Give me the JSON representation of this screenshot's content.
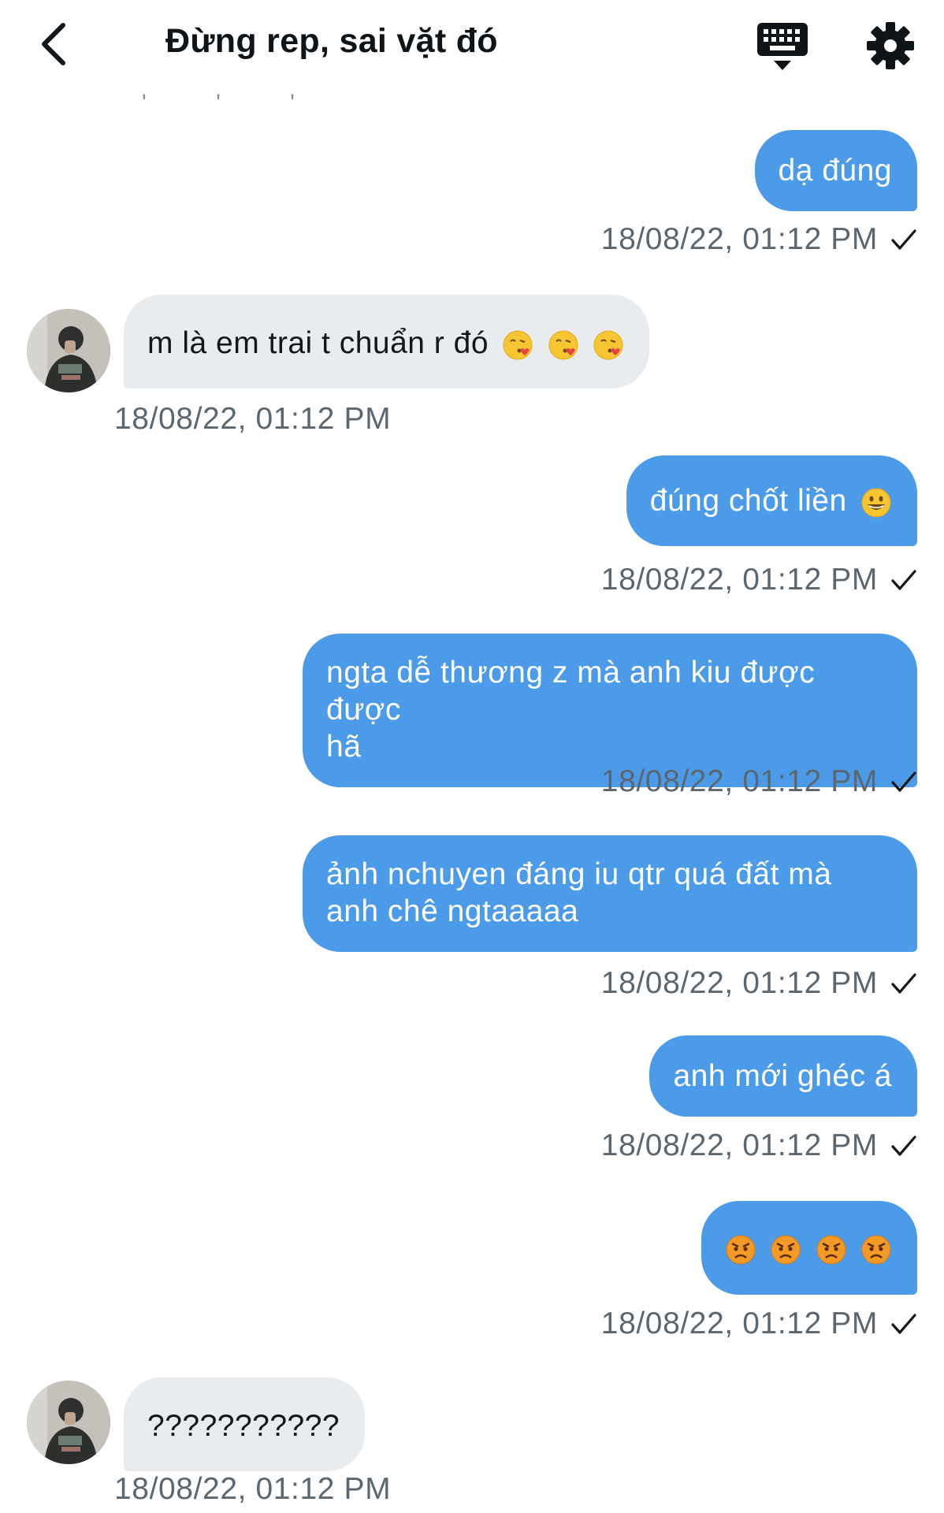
{
  "header": {
    "title": "Đừng rep, sai vặt đó"
  },
  "messages": [
    {
      "side": "sent",
      "text": "dạ đúng",
      "timestamp": "18/08/22, 01:12 PM"
    },
    {
      "side": "received",
      "text": "m là em trai t chuẩn r đó",
      "emoji": [
        "face-blowing-kiss",
        "face-blowing-kiss",
        "face-blowing-kiss"
      ],
      "timestamp": "18/08/22, 01:12 PM"
    },
    {
      "side": "sent",
      "text": "đúng chốt liền",
      "emoji": [
        "grinning-face"
      ],
      "timestamp": "18/08/22, 01:12 PM"
    },
    {
      "side": "sent",
      "line1": "ngta dễ thương z mà anh kiu được được",
      "line2": "hã",
      "timestamp": "18/08/22, 01:12 PM"
    },
    {
      "side": "sent",
      "line1": "ảnh nchuyen đáng iu qtr quá đất mà",
      "line2": "anh chê ngtaaaaa",
      "timestamp": "18/08/22, 01:12 PM"
    },
    {
      "side": "sent",
      "text": "anh mới ghéc á",
      "timestamp": "18/08/22, 01:12 PM"
    },
    {
      "side": "sent",
      "emoji": [
        "angry-face",
        "angry-face",
        "angry-face",
        "angry-face"
      ],
      "timestamp": "18/08/22, 01:12 PM"
    },
    {
      "side": "received",
      "text": "???????????",
      "timestamp": "18/08/22, 01:12 PM"
    }
  ],
  "colors": {
    "sent_bubble": "#4c9be8",
    "received_bubble": "#e8ecef",
    "timestamp": "#5b6770"
  }
}
